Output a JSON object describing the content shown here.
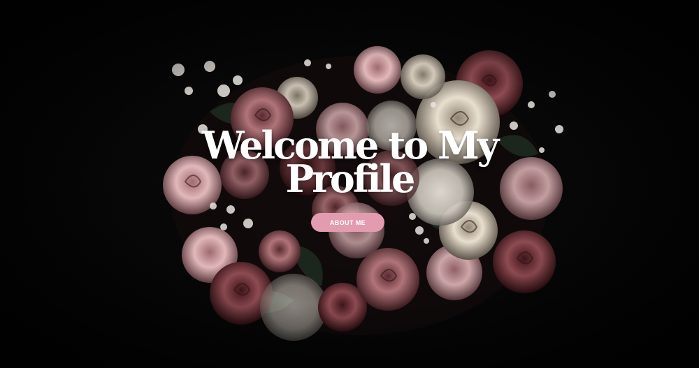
{
  "hero": {
    "title_line_1": "Welcome to My",
    "title_line_2": "Profile",
    "button_label": "ABOUT ME",
    "background_image": "dark-floral-bouquet"
  },
  "colors": {
    "background": "#050505",
    "button": "#e39bb0",
    "title": "#ffffff"
  }
}
